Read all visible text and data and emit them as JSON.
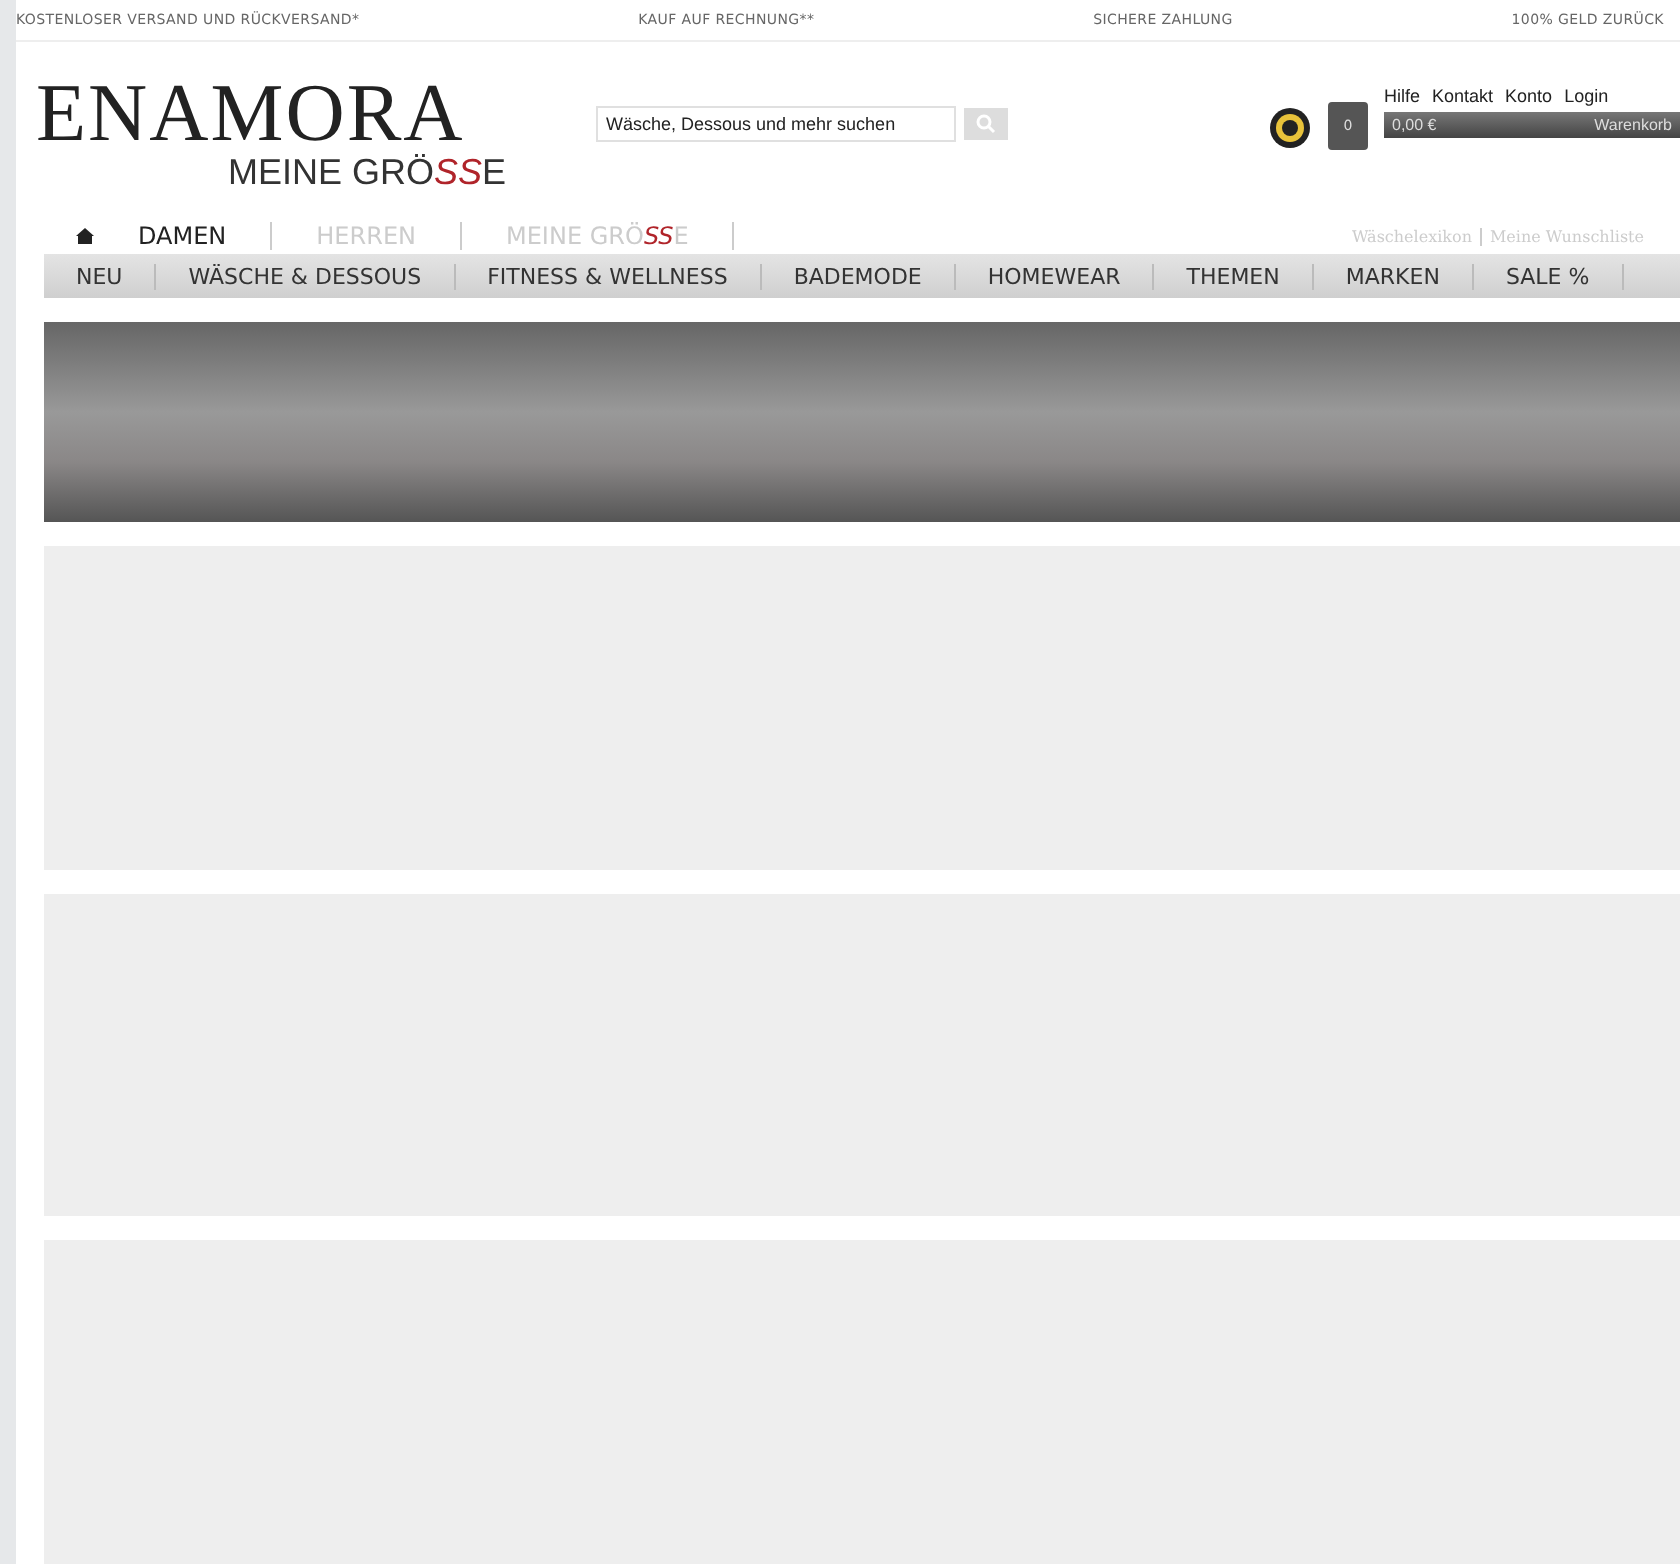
{
  "top_bar": [
    "KOSTENLOSER VERSAND UND RÜCKVERSAND*",
    "KAUF AUF RECHNUNG**",
    "SICHERE ZAHLUNG",
    "100% GELD ZURÜCK"
  ],
  "logo": {
    "name": "ENAMORA",
    "tagline": [
      {
        "text": "MEINE GRÖ",
        "accent": false
      },
      {
        "text": "SS",
        "accent": true
      },
      {
        "text": "E",
        "accent": false
      }
    ]
  },
  "search": {
    "placeholder": "Wäsche, Dessous und mehr suchen"
  },
  "cart": {
    "count": "0",
    "total": "0,00 €",
    "label": "Warenkorb"
  },
  "account_links": [
    "Hilfe",
    "Kontakt",
    "Konto",
    "Login"
  ],
  "gender_tabs": [
    {
      "label": [
        {
          "text": "DAMEN",
          "accent": false
        }
      ],
      "selected": true
    },
    {
      "label": [
        {
          "text": "HERREN",
          "accent": false
        }
      ],
      "selected": false
    },
    {
      "label": [
        {
          "text": "MEINE GRÖ",
          "accent": false
        },
        {
          "text": "SS",
          "accent": true
        },
        {
          "text": "E",
          "accent": false
        }
      ],
      "selected": false
    }
  ],
  "service_links": [
    "Wäschelexikon",
    "Meine Wunschliste"
  ],
  "menu": [
    "NEU",
    "WÄSCHE & DESSOUS",
    "FITNESS & WELLNESS",
    "BADEMODE",
    "HOMEWEAR",
    "THEMEN",
    "MARKEN",
    "SALE %"
  ],
  "content_blocks": [
    {
      "kind": "banner"
    },
    {
      "kind": "placeholder"
    },
    {
      "kind": "placeholder"
    },
    {
      "kind": "placeholder"
    }
  ]
}
